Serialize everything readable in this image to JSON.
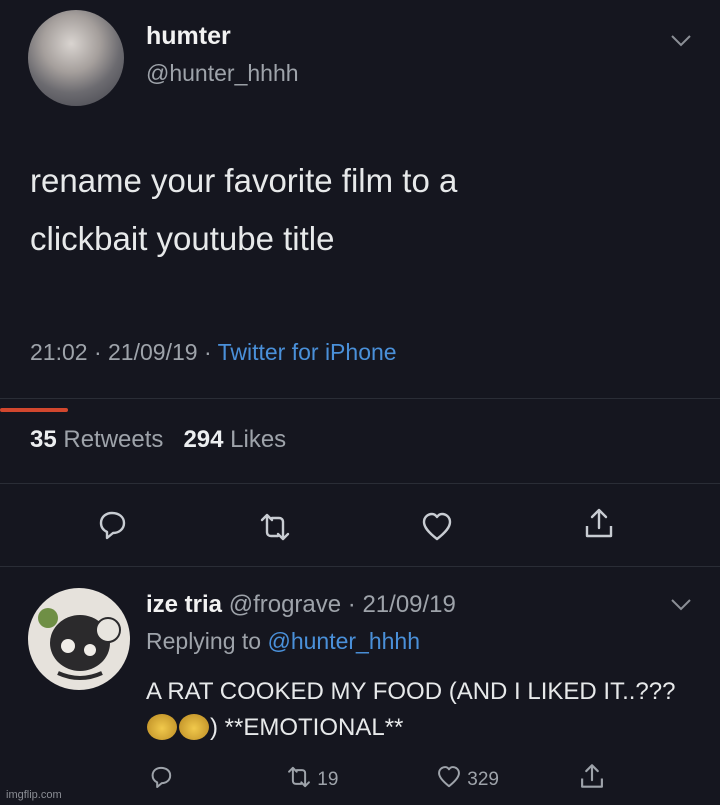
{
  "tweet": {
    "display_name": "humter",
    "handle": "@hunter_hhhh",
    "text_line1": "rename your favorite film to a",
    "text_line2": "clickbait youtube title",
    "time": "21:02",
    "date": "21/09/19",
    "separator": "·",
    "source": "Twitter for iPhone",
    "retweets_count": "35",
    "retweets_label": "Retweets",
    "likes_count": "294",
    "likes_label": "Likes",
    "icons": {
      "menu": "chevron-down-icon",
      "reply": "reply-icon",
      "retweet": "retweet-icon",
      "like": "heart-icon",
      "share": "share-icon"
    }
  },
  "reply": {
    "display_name": "ize tria",
    "handle": "@frograve",
    "separator": "·",
    "date": "21/09/19",
    "replying_label": "Replying to",
    "replying_to": "@hunter_hhhh",
    "text_part1": "A RAT COOKED MY FOOD (AND I LIKED IT..???",
    "text_part2": ") **EMOTIONAL**",
    "retweet_count": "19",
    "like_count": "329",
    "emoji": "flushed-face-emoji"
  },
  "watermark": "imgflip.com",
  "colors": {
    "background": "#15161f",
    "link": "#4a90d9",
    "muted": "#9ea3aa",
    "accent_mark": "#d2472e"
  }
}
